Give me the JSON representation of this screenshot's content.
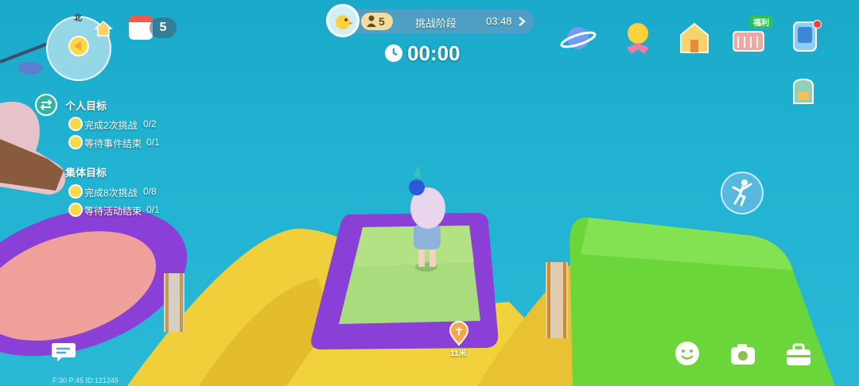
{
  "hud": {
    "stage_count": "5",
    "stage_label": "挑战阶段",
    "stage_time": "03:48",
    "timer": "00:00",
    "compass_north": "北",
    "calendar_count": "5",
    "welfare_badge": "福利",
    "distance": "11米",
    "debug_info": "F:30  P:45  ID:121245"
  },
  "goals": {
    "personal_title": "个人目标",
    "personal": [
      {
        "label": "完成2次挑战",
        "progress": "0/2"
      },
      {
        "label": "等待事件结束",
        "progress": "0/1"
      }
    ],
    "group_title": "集体目标",
    "group": [
      {
        "label": "完成8次挑战",
        "progress": "0/8"
      },
      {
        "label": "等待活动结束",
        "progress": "0/1"
      }
    ]
  },
  "colors": {
    "sky": "#22b3d2",
    "platform_frame": "#8a3fd6",
    "platform_center": "#a7df7a",
    "ramp": "#f2d23c",
    "green_block": "#6bd63a",
    "ring_pink": "#f3a3a0"
  },
  "icons": [
    "planet-icon",
    "duck-bow-icon",
    "gift-house-icon",
    "welfare-basket-icon",
    "phone-icon",
    "backpack-icon",
    "climb-icon",
    "emote-icon",
    "camera-icon",
    "toolbox-icon",
    "chat-icon"
  ]
}
